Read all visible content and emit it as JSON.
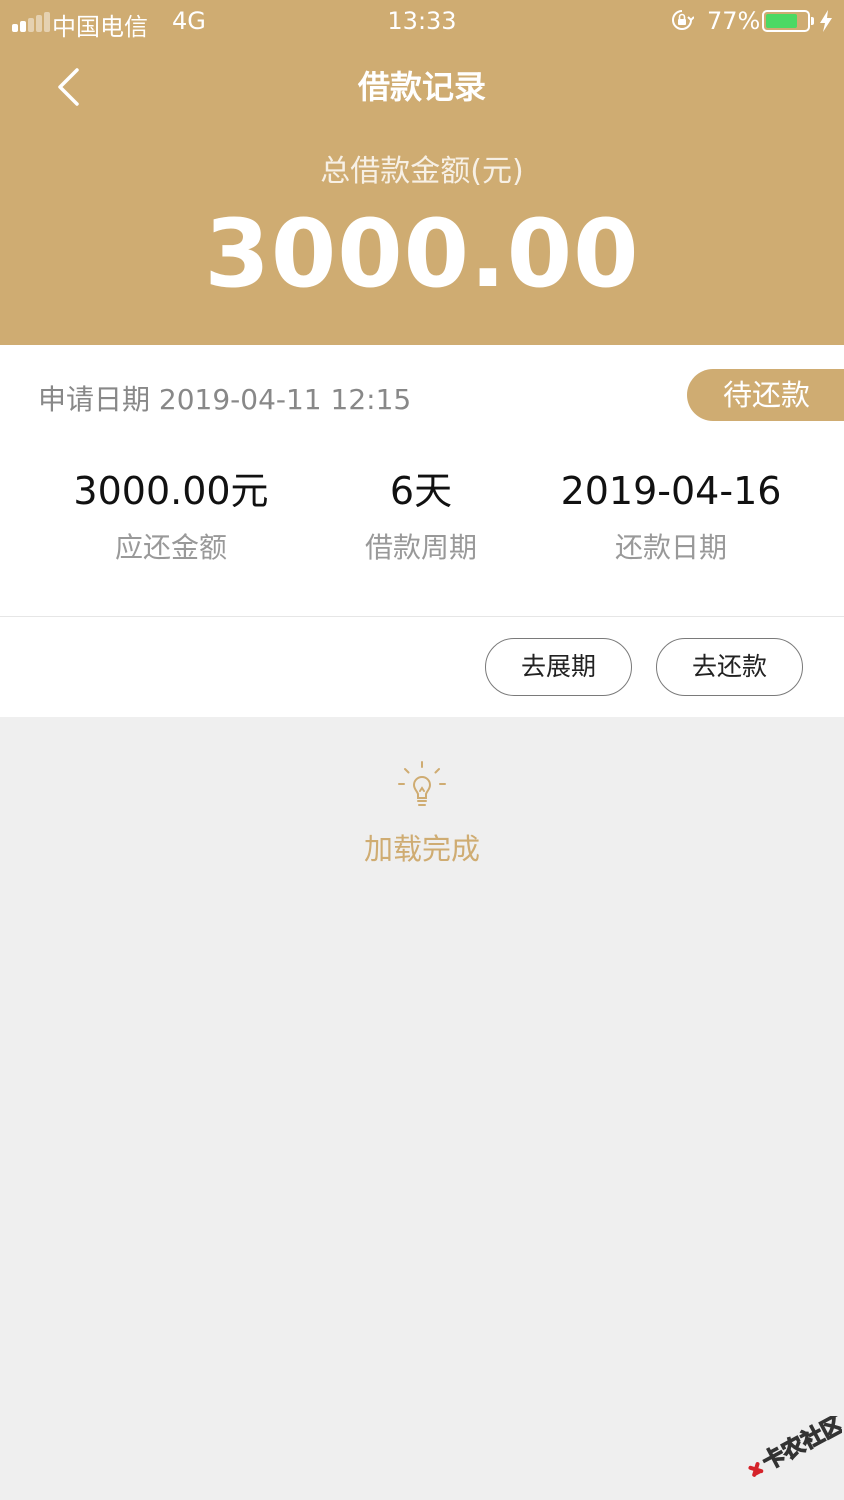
{
  "status_bar": {
    "carrier": "中国电信",
    "network": "4G",
    "time": "13:33",
    "battery_percent": "77%",
    "battery_level": 0.77,
    "signal_bars": 2
  },
  "nav": {
    "back_icon": "chevron-left-icon",
    "title": "借款记录"
  },
  "summary": {
    "total_label": "总借款金额(元)",
    "total_amount": "3000.00"
  },
  "loan": {
    "apply_date": "申请日期 2019-04-11 12:15",
    "status": "待还款",
    "details": [
      {
        "value": "3000.00元",
        "label": "应还金额"
      },
      {
        "value": "6天",
        "label": "借款周期"
      },
      {
        "value": "2019-04-16",
        "label": "还款日期"
      }
    ],
    "actions": {
      "extend": "去展期",
      "repay": "去还款"
    }
  },
  "footer": {
    "icon": "lightbulb-icon",
    "loaded_text": "加载完成"
  },
  "watermark": {
    "text": "卡农社区"
  },
  "colors": {
    "brand": "#cfac72",
    "background": "#efefef",
    "battery": "#4cd964"
  }
}
